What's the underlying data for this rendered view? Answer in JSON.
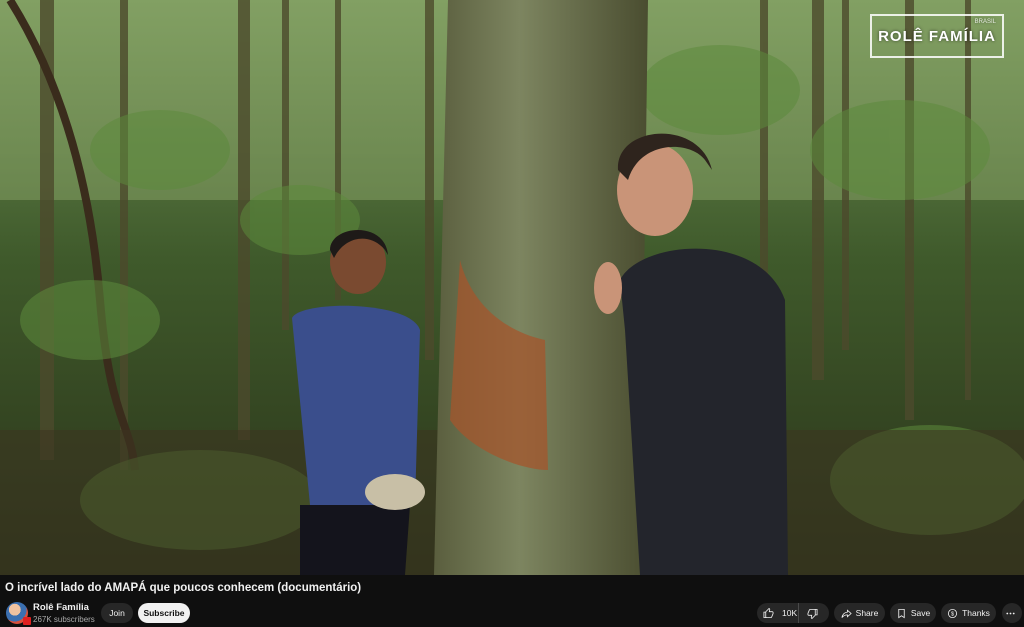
{
  "video": {
    "watermark": "ROLÊ FAMÍLIA",
    "watermark_sub": "BRASIL"
  },
  "meta": {
    "title": "O incrível lado do AMAPÁ que poucos conhecem (documentário)",
    "channel_name": "Rolê Família",
    "subscribers": "267K subscribers"
  },
  "actions": {
    "join_label": "Join",
    "subscribe_label": "Subscribe",
    "like_count": "10K",
    "share_label": "Share",
    "save_label": "Save",
    "thanks_label": "Thanks"
  },
  "icons": [
    "thumb-up-icon",
    "thumb-down-icon",
    "share-icon",
    "save-icon",
    "thanks-icon",
    "more-icon"
  ],
  "colors": {
    "background": "#0f0f0f",
    "pill": "#272727",
    "subscribe_bg": "#f1f1f1"
  }
}
